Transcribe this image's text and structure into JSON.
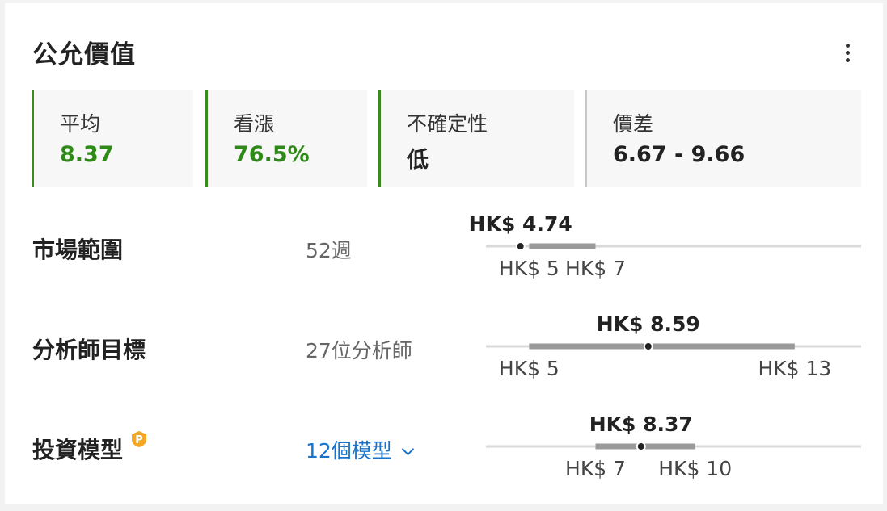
{
  "header": {
    "title": "公允價值",
    "menu_icon": "more-vertical-icon"
  },
  "stats": [
    {
      "label": "平均",
      "value": "8.37",
      "color": "#2e8a17"
    },
    {
      "label": "看漲",
      "value": "76.5%",
      "color": "#2e8a17"
    },
    {
      "label": "不確定性",
      "value": "低",
      "color": "#222222"
    },
    {
      "label": "價差",
      "value": "6.67 - 9.66",
      "color": "#222222"
    }
  ],
  "rows": {
    "market": {
      "label": "市場範圍",
      "sub": "52週",
      "current": "HK$ 4.74",
      "low": "HK$ 5",
      "high": "HK$ 7",
      "current_value": 4.74,
      "low_value": 5,
      "high_value": 7
    },
    "analyst": {
      "label": "分析師目標",
      "sub": "27位分析師",
      "current": "HK$ 8.59",
      "low": "HK$ 5",
      "high": "HK$ 13",
      "current_value": 8.59,
      "low_value": 5,
      "high_value": 13
    },
    "model": {
      "label": "投資模型",
      "sub": "12個模型",
      "current": "HK$ 8.37",
      "low": "HK$ 7",
      "high": "HK$ 10",
      "current_value": 8.37,
      "low_value": 7,
      "high_value": 10,
      "badge_icon": "pro-badge-icon",
      "dropdown_icon": "chevron-down-icon"
    }
  },
  "colors": {
    "bullish": "#2e8a17",
    "neutral_border": "#c8c8c8",
    "link": "#1a73c9",
    "bar": "#9a9a9a",
    "track": "#d9d9d9",
    "pro_badge": "#f5a623"
  }
}
